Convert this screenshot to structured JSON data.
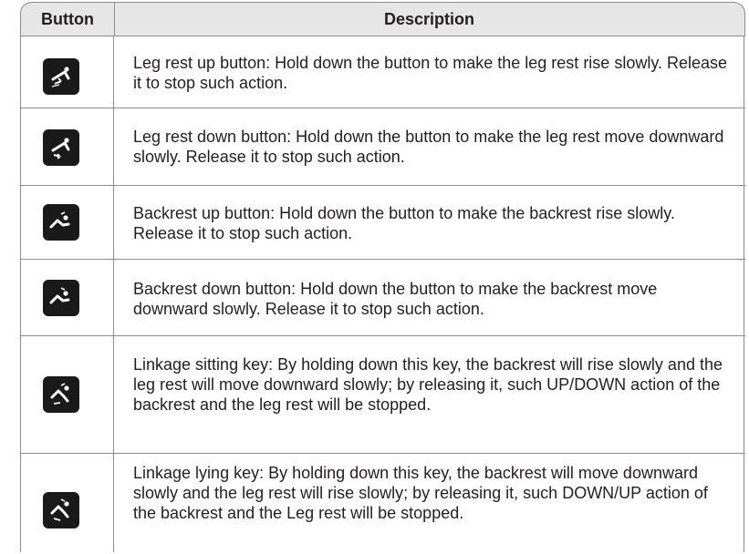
{
  "header": {
    "button": "Button",
    "description": "Description"
  },
  "rows": [
    {
      "icon": "leg-rest-up-icon",
      "text": "Leg rest up button: Hold down the button to make the leg rest rise slowly. Release it to stop such action."
    },
    {
      "icon": "leg-rest-down-icon",
      "text": "Leg rest down button: Hold down the button to make the leg rest move downward slowly. Release it to stop such action."
    },
    {
      "icon": "backrest-up-icon",
      "text": "Backrest up button: Hold down the button to make the backrest rise slowly. Release it to stop such action."
    },
    {
      "icon": "backrest-down-icon",
      "text": "Backrest down button: Hold down the button to make the backrest move downward slowly. Release it to stop such action."
    },
    {
      "icon": "linkage-sitting-icon",
      "text": "Linkage sitting key: By holding down this key, the backrest will rise slowly and the leg rest will move downward slowly; by releasing it, such UP/DOWN action of the backrest and the leg rest will be stopped."
    },
    {
      "icon": "linkage-lying-icon",
      "text": "Linkage lying key: By holding down this key, the backrest will move downward slowly and the leg rest will rise slowly; by releasing it, such DOWN/UP action of the backrest and the Leg rest will be stopped."
    }
  ]
}
